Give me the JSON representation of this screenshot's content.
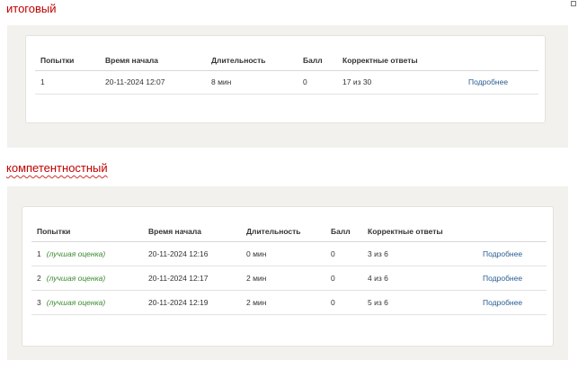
{
  "sections": [
    {
      "title": "итоговый",
      "headers": [
        "Попытки",
        "Время начала",
        "Длительность",
        "Балл",
        "Корректные ответы",
        ""
      ],
      "rows": [
        {
          "attempt": "1",
          "best": "",
          "start": "20-11-2024 12:07",
          "duration": "8 мин",
          "score": "0",
          "correct": "17 из 30",
          "details": "Подробнее"
        }
      ]
    },
    {
      "title": "компетентностный",
      "headers": [
        "Попытки",
        "Время начала",
        "Длительность",
        "Балл",
        "Корректные ответы",
        ""
      ],
      "rows": [
        {
          "attempt": "1",
          "best": "(лучшая оценка)",
          "start": "20-11-2024 12:16",
          "duration": "0 мин",
          "score": "0",
          "correct": "3 из 6",
          "details": "Подробнее"
        },
        {
          "attempt": "2",
          "best": "(лучшая оценка)",
          "start": "20-11-2024 12:17",
          "duration": "2 мин",
          "score": "0",
          "correct": "4 из 6",
          "details": "Подробнее"
        },
        {
          "attempt": "3",
          "best": "(лучшая оценка)",
          "start": "20-11-2024 12:19",
          "duration": "2 мин",
          "score": "0",
          "correct": "5 из 6",
          "details": "Подробнее"
        }
      ]
    }
  ],
  "colors": {
    "section_title": "#c00000",
    "panel_bg": "#f2f1ee",
    "link": "#2a5d93",
    "best_note": "#3a8a30"
  }
}
